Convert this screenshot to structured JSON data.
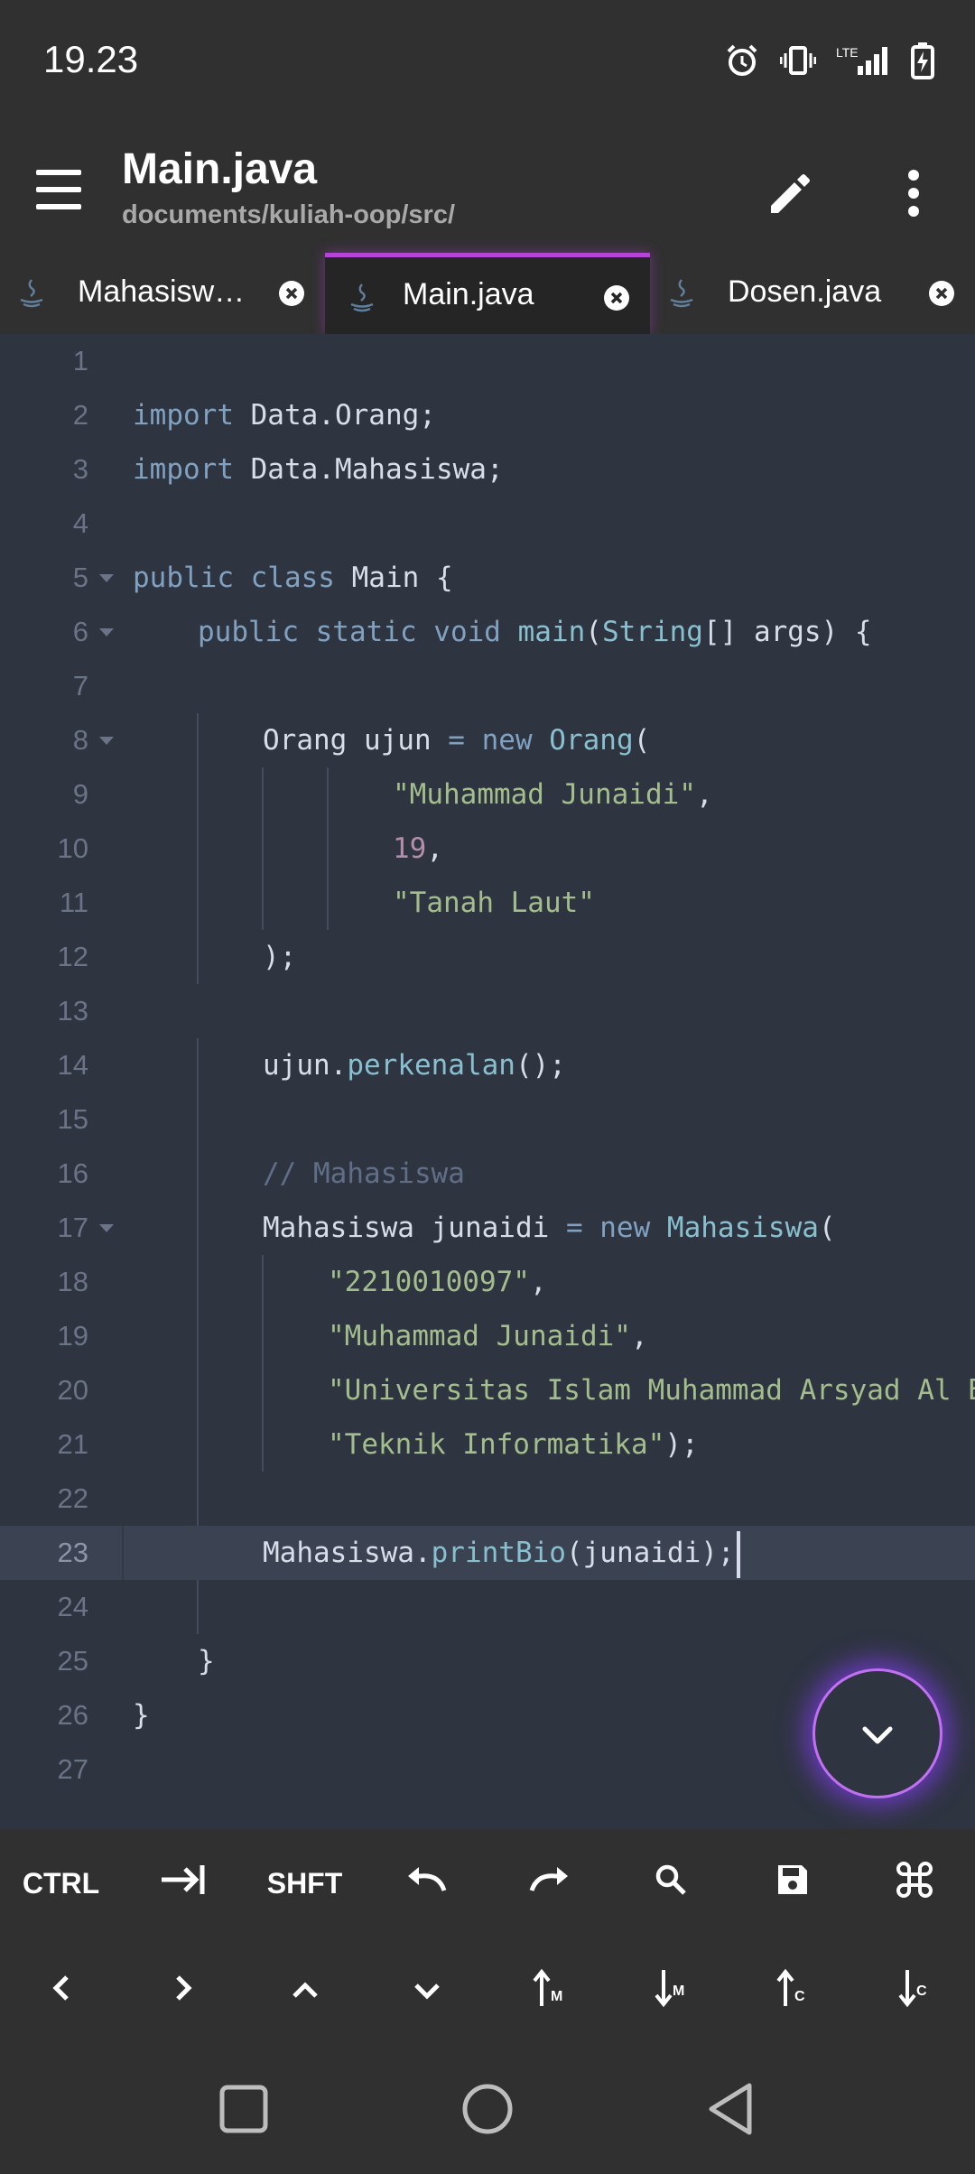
{
  "status": {
    "time": "19.23",
    "network_label": "LTE"
  },
  "appbar": {
    "title": "Main.java",
    "path": "documents/kuliah-oop/src/"
  },
  "tabs": [
    {
      "label": "Mahasiswa…",
      "active": false
    },
    {
      "label": "Main.java",
      "active": true
    },
    {
      "label": "Dosen.java",
      "active": false
    }
  ],
  "editor": {
    "current_line": 23,
    "line_numbers": [
      "1",
      "2",
      "3",
      "4",
      "5",
      "6",
      "7",
      "8",
      "9",
      "10",
      "11",
      "12",
      "13",
      "14",
      "15",
      "16",
      "17",
      "18",
      "19",
      "20",
      "21",
      "22",
      "23",
      "24",
      "25",
      "26",
      "27"
    ],
    "tokens": {
      "import": "import",
      "pkg_orang": " Data.Orang;",
      "pkg_mhs": " Data.Mahasiswa;",
      "public": "public",
      "class": " class",
      "main_class": " Main {",
      "static": " static",
      "void": " void",
      "main": " main",
      "open_paren": "(",
      "String": "String",
      "args": "[] args) {",
      "orang_decl": "Orang ujun",
      "eq": " =",
      "new": " new",
      "Orang": " Orang",
      "s_muhammad": "\"Muhammad Junaidi\"",
      "comma": ",",
      "n19": "19",
      "s_tanah": "\"Tanah Laut\"",
      "close_stmt": ");",
      "ujun": "ujun.",
      "perkenalan": "perkenalan",
      "call_end": "();",
      "comment": "// Mahasiswa",
      "mhs_decl": "Mahasiswa junaidi",
      "Mahasiswa": " Mahasiswa",
      "s_nim": "\"2210010097\"",
      "s_univ": "\"Universitas Islam Muhammad Arsyad Al Banjari\"",
      "s_teknik": "\"Teknik Informatika\"",
      "mhs_static": "Mahasiswa.",
      "printBio": "printBio",
      "print_args": "(junaidi);",
      "close_brace": "}"
    }
  },
  "keys": {
    "row1": [
      "CTRL",
      "tab-icon",
      "SHFT",
      "undo-icon",
      "redo-icon",
      "search-icon",
      "save-icon",
      "command-icon"
    ],
    "ctrl": "CTRL",
    "shft": "SHFT",
    "row2": [
      "left-arrow",
      "right-arrow",
      "up-arrow",
      "down-arrow",
      "move-line-up",
      "move-line-down",
      "copy-line-up",
      "copy-line-down"
    ],
    "m": "M",
    "c": "C"
  },
  "colors": {
    "editor_bg": "#2e3440",
    "keyword": "#81a1c1",
    "function": "#88c0d0",
    "string": "#a3be8c",
    "number": "#b48ead",
    "comment": "#616e88",
    "tab_accent": "#b544d8"
  }
}
